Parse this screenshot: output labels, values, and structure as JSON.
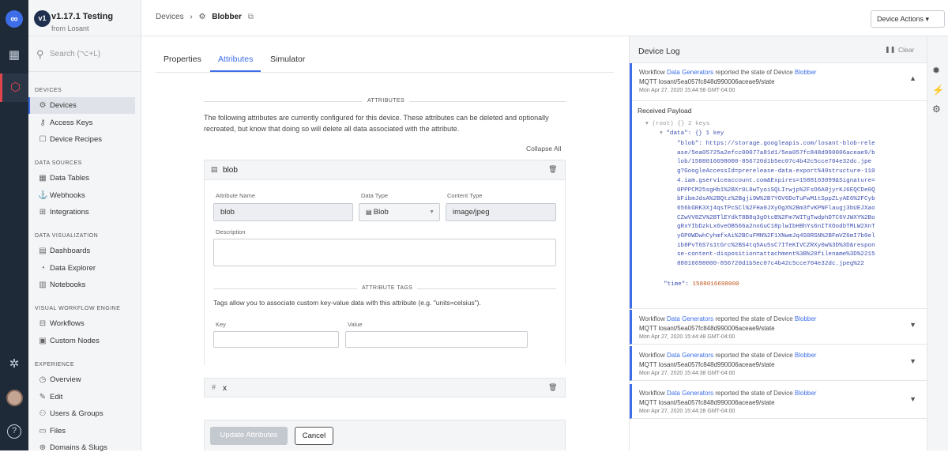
{
  "rail": {
    "logo": "∞"
  },
  "app": {
    "badge": "v1",
    "title": "v1.17.1 Testing",
    "subtitle": "from Losant"
  },
  "search": {
    "placeholder": "Search (⌥+L)"
  },
  "sidebar": {
    "sections": [
      {
        "title": "DEVICES",
        "items": [
          "Devices",
          "Access Keys",
          "Device Recipes"
        ]
      },
      {
        "title": "DATA SOURCES",
        "items": [
          "Data Tables",
          "Webhooks",
          "Integrations"
        ]
      },
      {
        "title": "DATA VISUALIZATION",
        "items": [
          "Dashboards",
          "Data Explorer",
          "Notebooks"
        ]
      },
      {
        "title": "VISUAL WORKFLOW ENGINE",
        "items": [
          "Workflows",
          "Custom Nodes"
        ]
      },
      {
        "title": "EXPERIENCE",
        "items": [
          "Overview",
          "Edit",
          "Users & Groups",
          "Files",
          "Domains & Slugs"
        ]
      }
    ]
  },
  "header": {
    "crumb_root": "Devices",
    "crumb_sep": "›",
    "crumb_current": "Blobber",
    "actions_label": "Device Actions ▾"
  },
  "tabs": [
    "Properties",
    "Attributes",
    "Simulator"
  ],
  "attributes": {
    "heading": "ATTRIBUTES",
    "intro": "The following attributes are currently configured for this device. These attributes can be deleted and optionally recreated, but know that doing so will delete all data associated with the attribute.",
    "collapse_all": "Collapse All",
    "blob": {
      "name": "blob",
      "name_label": "Attribute Name",
      "name_value": "blob",
      "type_label": "Data Type",
      "type_value": "Blob",
      "content_label": "Content Type",
      "content_value": "image/jpeg",
      "desc_label": "Description",
      "tags_heading": "ATTRIBUTE TAGS",
      "tags_text": "Tags allow you to associate custom key-value data with this attribute (e.g. \"units=celsius\").",
      "key_label": "Key",
      "value_label": "Value"
    },
    "x": {
      "name": "x",
      "hash": "#"
    },
    "update_label": "Update Attributes",
    "cancel_label": "Cancel"
  },
  "log": {
    "title": "Device Log",
    "clear": "Clear",
    "payload_label": "Received Payload",
    "root_line": "(root)  {}  2 keys",
    "data_line": "\"data\":  {}  1 key",
    "blob_key": "\"blob\":",
    "blob_value_lines": [
      "\"blob\": https://storage.googleapis.com/losant-blob-rele",
      "ase/5ea05725a2efcc00077a81d1/5ea057fc848d990006aceae9/b",
      "lob/1588016698000-856720d1b5ec07c4b42c5cce704e32dc.jpe",
      "g?GoogleAccessId=prerelease-data-export%40structure-110",
      "4.iam.gserviceaccount.com&Expires=1588103099&Signature=",
      "0PPPCM25sgHb1%2BXr0L8wTyoiSQLIrwjp%2FsO6A8jyrKJ6EQCDe0Q",
      "bFibmJdsA%2BQtz%2Bgji9W%2B7YGV6DoTuFwM1tSppZLyAE6%2FCyb",
      "656kGRK3Xj4qsTPcSCl%2FHa0JXyOgX%2Bm3fvKPNFlaugj3bUEJXao",
      "CZwVV8ZV%2BTlEYdkT8B8q3gOtcB%2Fm7WITgTwdphDTC6VJWXY%2Bo",
      "gRxYIbDzkLx6veOB566a2nxGuC18plwIbHBhYs6nITXOodbTMLW2XnT",
      "yGP0WDwhCyhmfxAi%2BCuFMN%2F1XNwmJq4S0RSN%2BFmVZ6mI7b0el",
      "ib8PvT6S7s1tGrc%2BS4tq5Au5sC7ITeKIVCZRXy0w%3D%3D&respon",
      "se-content-disposition=attachment%3B%20filename%3D%2215",
      "88016698000-856720d1b5ec07c4b42c5cce704e32dc.jpeg%22"
    ],
    "time_key": "\"time\":",
    "time_value": "1588016698000",
    "entries": [
      {
        "prefix": "Workflow",
        "workflow": "Data Generators",
        "middle": "reported the state of Device",
        "device": "Blobber",
        "topic": "MQTT  losant/5ea057fc848d990006aceae9/state",
        "date": "Mon Apr 27, 2020 15:44:58 GMT-04:00"
      },
      {
        "prefix": "Workflow",
        "workflow": "Data Generators",
        "middle": "reported the state of Device",
        "device": "Blobber",
        "topic": "MQTT  losant/5ea057fc848d990006aceae9/state",
        "date": "Mon Apr 27, 2020 15:44:48 GMT-04:00"
      },
      {
        "prefix": "Workflow",
        "workflow": "Data Generators",
        "middle": "reported the state of Device",
        "device": "Blobber",
        "topic": "MQTT  losant/5ea057fc848d990006aceae9/state",
        "date": "Mon Apr 27, 2020 15:44:38 GMT-04:00"
      },
      {
        "prefix": "Workflow",
        "workflow": "Data Generators",
        "middle": "reported the state of Device",
        "device": "Blobber",
        "topic": "MQTT  losant/5ea057fc848d990006aceae9/state",
        "date": "Mon Apr 27, 2020 15:44:28 GMT-04:00"
      }
    ]
  },
  "colors": {
    "accent": "#3d6ee8",
    "rail": "#1f2a38",
    "danger": "#e0454c"
  }
}
